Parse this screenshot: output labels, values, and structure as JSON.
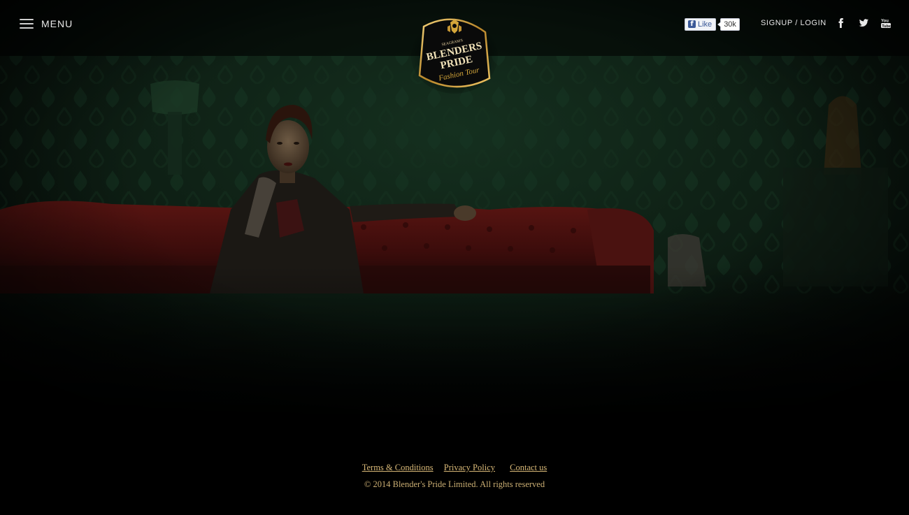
{
  "header": {
    "menu_label": "MENU",
    "logo": {
      "maker": "SEAGRAM'S",
      "line1": "BLENDERS",
      "line2": "PRIDE",
      "tagline": "Fashion Tour"
    },
    "fb_like": {
      "label": "Like",
      "count": "30k"
    },
    "auth": {
      "signup": "SIGNUP",
      "separator": "/",
      "login": "LOGIN"
    },
    "social_icons": [
      "facebook-icon",
      "twitter-icon",
      "youtube-icon"
    ]
  },
  "footer": {
    "links": [
      "Terms & Conditions",
      "Privacy Policy",
      "Contact us"
    ],
    "copyright": "© 2014 Blender's Pride  Limited. All rights reserved"
  },
  "colors": {
    "background": "#000000",
    "footer_text": "#d8b877",
    "header_text": "#e8e8e8",
    "logo_gold": "#d4a63a"
  }
}
